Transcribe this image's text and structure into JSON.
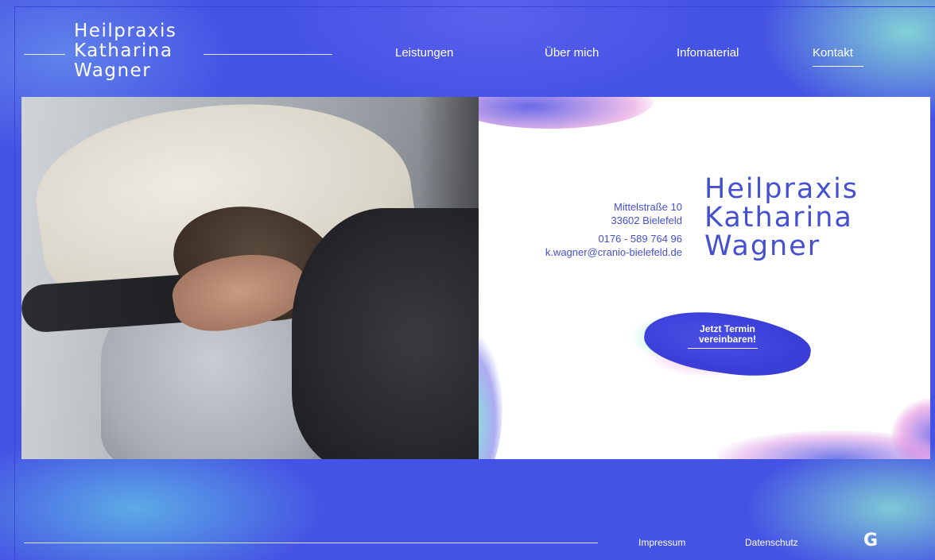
{
  "header": {
    "logo_lines": [
      "Heilpraxis",
      "Katharina",
      "Wagner"
    ],
    "nav": [
      {
        "label": "Leistungen"
      },
      {
        "label": "Über mich"
      },
      {
        "label": "Infomaterial"
      },
      {
        "label": "Kontakt",
        "active": true
      }
    ]
  },
  "hero": {
    "image_alt": "Therapeutin hält den Kopf eines liegenden Patienten",
    "address_street": "Mittelstraße 10",
    "address_city": "33602 Bielefeld",
    "phone": "0176 - 589 764 96",
    "email": "k.wagner@cranio-bielefeld.de",
    "brand_lines": [
      "Heilpraxis",
      "Katharina",
      "Wagner"
    ],
    "cta_line1": "Jetzt Termin",
    "cta_line2": "vereinbaren!"
  },
  "footer": {
    "impressum": "Impressum",
    "datenschutz": "Datenschutz",
    "icon": "google-g-icon",
    "icon_glyph": "G"
  },
  "colors": {
    "primary_blue": "#4553e4",
    "text_blue": "#4450cf",
    "accent_mint": "#8ce6d2",
    "accent_pink": "#f0a0dc"
  }
}
